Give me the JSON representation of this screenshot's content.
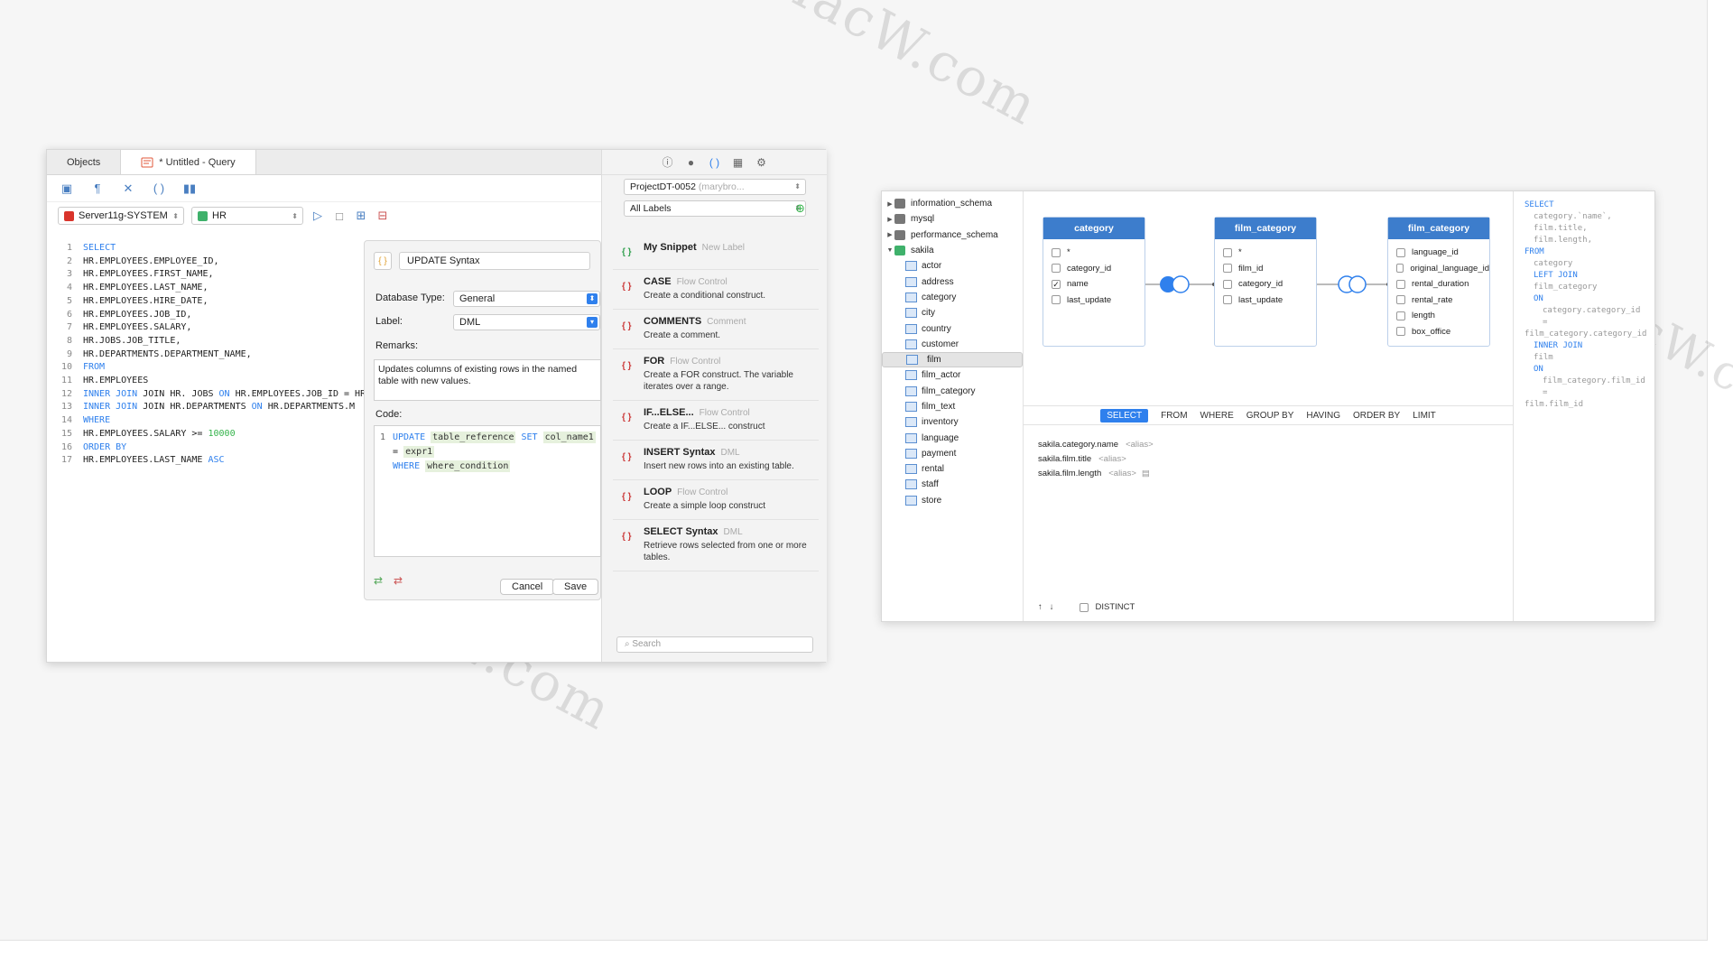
{
  "left_window": {
    "tabs": [
      {
        "label": "Objects"
      },
      {
        "label": "* Untitled - Query"
      }
    ],
    "connection": "Server11g-SYSTEM",
    "schema": "HR",
    "code_lines": [
      {
        "num": "1",
        "segs": [
          {
            "t": "SELECT",
            "c": "kw"
          }
        ]
      },
      {
        "num": "2",
        "segs": [
          {
            "t": "HR.EMPLOYEES.EMPLOYEE_ID,",
            "c": ""
          }
        ]
      },
      {
        "num": "3",
        "segs": [
          {
            "t": "HR.EMPLOYEES.FIRST_NAME,",
            "c": ""
          }
        ]
      },
      {
        "num": "4",
        "segs": [
          {
            "t": "HR.EMPLOYEES.LAST_NAME,",
            "c": ""
          }
        ]
      },
      {
        "num": "5",
        "segs": [
          {
            "t": "HR.EMPLOYEES.HIRE_DATE,",
            "c": ""
          }
        ]
      },
      {
        "num": "6",
        "segs": [
          {
            "t": "HR.EMPLOYEES.JOB_ID,",
            "c": ""
          }
        ]
      },
      {
        "num": "7",
        "segs": [
          {
            "t": "HR.EMPLOYEES.SALARY,",
            "c": ""
          }
        ]
      },
      {
        "num": "8",
        "segs": [
          {
            "t": "HR.JOBS.JOB_TITLE,",
            "c": ""
          }
        ]
      },
      {
        "num": "9",
        "segs": [
          {
            "t": "HR.DEPARTMENTS.DEPARTMENT_NAME,",
            "c": ""
          }
        ]
      },
      {
        "num": "10",
        "segs": [
          {
            "t": "FROM",
            "c": "kw"
          }
        ]
      },
      {
        "num": "11",
        "segs": [
          {
            "t": "HR.EMPLOYEES",
            "c": ""
          }
        ]
      },
      {
        "num": "12",
        "segs": [
          {
            "t": "INNER JOIN",
            "c": "kw"
          },
          {
            "t": " JOIN HR. JOBS ",
            "c": ""
          },
          {
            "t": "ON",
            "c": "kw"
          },
          {
            "t": " HR.EMPLOYEES.JOB_ID = HR ...",
            "c": ""
          }
        ]
      },
      {
        "num": "13",
        "segs": [
          {
            "t": "INNER JOIN",
            "c": "kw"
          },
          {
            "t": " JOIN HR.DEPARTMENTS ",
            "c": ""
          },
          {
            "t": "ON",
            "c": "kw"
          },
          {
            "t": " HR.DEPARTMENTS.M",
            "c": ""
          }
        ]
      },
      {
        "num": "14",
        "segs": [
          {
            "t": "WHERE",
            "c": "kw"
          }
        ]
      },
      {
        "num": "15",
        "segs": [
          {
            "t": "HR.EMPLOYEES.SALARY >= ",
            "c": ""
          },
          {
            "t": "10000",
            "c": "num"
          }
        ]
      },
      {
        "num": "16",
        "segs": [
          {
            "t": "ORDER BY",
            "c": "kw"
          }
        ]
      },
      {
        "num": "17",
        "segs": [
          {
            "t": "HR.EMPLOYEES.LAST_NAME ",
            "c": ""
          },
          {
            "t": "ASC",
            "c": "kw"
          }
        ]
      }
    ],
    "dialog": {
      "name": "UPDATE Syntax",
      "db_type_label": "Database Type:",
      "db_type_value": "General",
      "label_label": "Label:",
      "label_value": "DML",
      "remarks_label": "Remarks:",
      "remarks": "Updates columns of existing rows in the named table with new values.",
      "code_label": "Code:",
      "code_line_num": "1",
      "code_tokens": {
        "update": "UPDATE",
        "table_ref": "table_reference",
        "set": "SET",
        "col": "col_name1",
        "eq": "=",
        "expr": "expr1",
        "where": "WHERE",
        "cond": "where_condition"
      },
      "cancel": "Cancel",
      "save": "Save"
    },
    "snippet_panel": {
      "project": "ProjectDT-0052",
      "project_hint": "(marybro...",
      "labels_filter": "All Labels",
      "items": [
        {
          "title": "My Snippet",
          "label": "New Label",
          "desc": ""
        },
        {
          "title": "CASE",
          "label": "Flow Control",
          "desc": "Create a conditional construct."
        },
        {
          "title": "COMMENTS",
          "label": "Comment",
          "desc": "Create a comment."
        },
        {
          "title": "FOR",
          "label": "Flow Control",
          "desc": "Create a FOR construct. The variable iterates over a range."
        },
        {
          "title": "IF...ELSE...",
          "label": "Flow Control",
          "desc": "Create a IF...ELSE... construct"
        },
        {
          "title": "INSERT Syntax",
          "label": "DML",
          "desc": "Insert new rows into an existing table."
        },
        {
          "title": "LOOP",
          "label": "Flow Control",
          "desc": "Create a simple loop construct"
        },
        {
          "title": "SELECT Syntax",
          "label": "DML",
          "desc": "Retrieve rows selected from one or more tables."
        }
      ],
      "search_placeholder": "Search"
    }
  },
  "right_window": {
    "tree": [
      {
        "label": "information_schema",
        "kind": "db",
        "toggle": "▶"
      },
      {
        "label": "mysql",
        "kind": "db",
        "toggle": "▶"
      },
      {
        "label": "performance_schema",
        "kind": "db",
        "toggle": "▶"
      },
      {
        "label": "sakila",
        "kind": "db-open",
        "toggle": "▼"
      },
      {
        "label": "actor",
        "kind": "table"
      },
      {
        "label": "address",
        "kind": "table"
      },
      {
        "label": "category",
        "kind": "table"
      },
      {
        "label": "city",
        "kind": "table"
      },
      {
        "label": "country",
        "kind": "table"
      },
      {
        "label": "customer",
        "kind": "table"
      },
      {
        "label": "film",
        "kind": "table",
        "selected": true
      },
      {
        "label": "film_actor",
        "kind": "table"
      },
      {
        "label": "film_category",
        "kind": "table"
      },
      {
        "label": "film_text",
        "kind": "table"
      },
      {
        "label": "inventory",
        "kind": "table"
      },
      {
        "label": "language",
        "kind": "table"
      },
      {
        "label": "payment",
        "kind": "table"
      },
      {
        "label": "rental",
        "kind": "table"
      },
      {
        "label": "staff",
        "kind": "table"
      },
      {
        "label": "store",
        "kind": "table"
      }
    ],
    "entities": [
      {
        "title": "category",
        "fields": [
          {
            "n": "*",
            "c": false
          },
          {
            "n": "category_id",
            "c": false
          },
          {
            "n": "name",
            "c": true
          },
          {
            "n": "last_update",
            "c": false
          }
        ]
      },
      {
        "title": "film_category",
        "fields": [
          {
            "n": "*",
            "c": false
          },
          {
            "n": "film_id",
            "c": false
          },
          {
            "n": "category_id",
            "c": false
          },
          {
            "n": "last_update",
            "c": false
          }
        ]
      },
      {
        "title": "film_category",
        "fields": [
          {
            "n": "language_id",
            "c": false
          },
          {
            "n": "original_language_id",
            "c": false
          },
          {
            "n": "rental_duration",
            "c": false
          },
          {
            "n": "rental_rate",
            "c": false
          },
          {
            "n": "length",
            "c": false
          },
          {
            "n": "box_office",
            "c": false
          }
        ]
      }
    ],
    "clauses": [
      "SELECT",
      "FROM",
      "WHERE",
      "GROUP BY",
      "HAVING",
      "ORDER BY",
      "LIMIT"
    ],
    "active_clause": "SELECT",
    "selected_fields": [
      {
        "name": "sakila.category.name",
        "alias": "<alias>"
      },
      {
        "name": "sakila.film.title",
        "alias": "<alias>"
      },
      {
        "name": "sakila.film.length",
        "alias": "<alias>"
      }
    ],
    "distinct_label": "DISTINCT",
    "sql_preview": [
      {
        "t": "SELECT",
        "k": true,
        "i": 0
      },
      {
        "t": "category.`name`,",
        "k": false,
        "i": 1
      },
      {
        "t": "film.title,",
        "k": false,
        "i": 1
      },
      {
        "t": "film.length,",
        "k": false,
        "i": 1
      },
      {
        "t": "FROM",
        "k": true,
        "i": 0
      },
      {
        "t": "category",
        "k": false,
        "i": 1
      },
      {
        "t": "LEFT JOIN",
        "k": true,
        "i": 1
      },
      {
        "t": "film_category",
        "k": false,
        "i": 1
      },
      {
        "t": "ON",
        "k": true,
        "i": 1
      },
      {
        "t": "category.category_id =",
        "k": false,
        "i": 2
      },
      {
        "t": "film_category.category_id",
        "k": false,
        "i": 0
      },
      {
        "t": "INNER JOIN",
        "k": true,
        "i": 1
      },
      {
        "t": "film",
        "k": false,
        "i": 1
      },
      {
        "t": "ON",
        "k": true,
        "i": 1
      },
      {
        "t": "film_category.film_id =",
        "k": false,
        "i": 2
      },
      {
        "t": "film.film_id",
        "k": false,
        "i": 0
      }
    ]
  },
  "watermark": "MacW.com",
  "colors": {
    "accent": "#2f80ed",
    "header_blue": "#3d7dcc",
    "keyword": "#2f80ed",
    "number": "#33b34a"
  }
}
